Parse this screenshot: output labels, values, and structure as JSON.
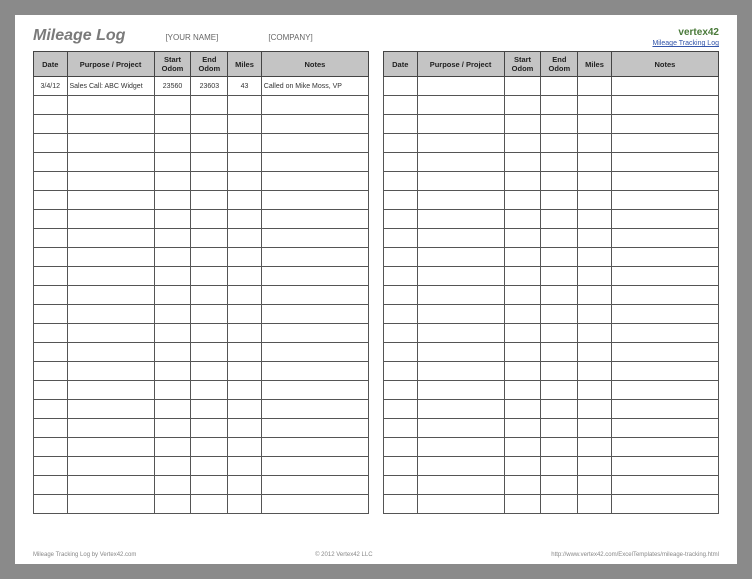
{
  "header": {
    "title": "Mileage Log",
    "name_placeholder": "[YOUR NAME]",
    "company_placeholder": "[COMPANY]"
  },
  "brand": {
    "name": "vertex42",
    "link_text": "Mileage Tracking Log"
  },
  "columns": {
    "date": "Date",
    "purpose": "Purpose / Project",
    "start": "Start Odom",
    "end": "End Odom",
    "miles": "Miles",
    "notes": "Notes"
  },
  "left_rows": [
    {
      "date": "3/4/12",
      "purpose": "Sales Call: ABC Widget",
      "start": "23560",
      "end": "23603",
      "miles": "43",
      "notes": "Called on Mike Moss, VP"
    },
    {},
    {},
    {},
    {},
    {},
    {},
    {},
    {},
    {},
    {},
    {},
    {},
    {},
    {},
    {},
    {},
    {},
    {},
    {},
    {},
    {},
    {}
  ],
  "right_rows": [
    {},
    {},
    {},
    {},
    {},
    {},
    {},
    {},
    {},
    {},
    {},
    {},
    {},
    {},
    {},
    {},
    {},
    {},
    {},
    {},
    {},
    {},
    {}
  ],
  "footer": {
    "left": "Mileage Tracking Log by Vertex42.com",
    "center": "© 2012 Vertex42 LLC",
    "right": "http://www.vertex42.com/ExcelTemplates/mileage-tracking.html"
  }
}
